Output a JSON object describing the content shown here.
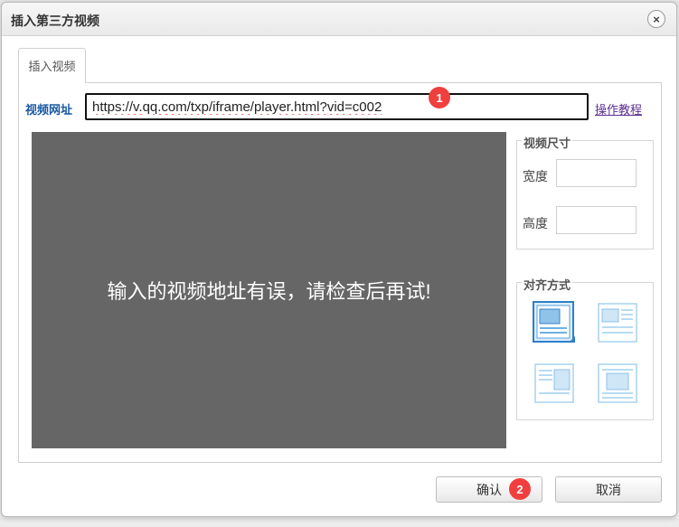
{
  "dialog": {
    "title": "插入第三方视频",
    "close_icon": "×"
  },
  "tabs": [
    {
      "label": "插入视频"
    }
  ],
  "url_row": {
    "label": "视频网址",
    "value": "https://v.qq.com/txp/iframe/player.html?vid=c002",
    "tutorial_link": "操作教程"
  },
  "preview": {
    "message": "输入的视频地址有误，请检查后再试!"
  },
  "video_size": {
    "legend": "视频尺寸",
    "width_label": "宽度",
    "width_value": "",
    "height_label": "高度",
    "height_value": ""
  },
  "alignment": {
    "legend": "对齐方式",
    "options": [
      {
        "icon": "align-none-icon",
        "selected": true
      },
      {
        "icon": "align-left-icon",
        "selected": false
      },
      {
        "icon": "align-right-icon",
        "selected": false
      },
      {
        "icon": "align-center-icon",
        "selected": false
      }
    ]
  },
  "footer": {
    "confirm_label": "确认",
    "cancel_label": "取消"
  },
  "badges": [
    "1",
    "2"
  ],
  "colors": {
    "preview_bg": "#666666",
    "badge": "#f03f3f",
    "label_blue": "#1a5aa3",
    "link_purple": "#5b2f91"
  }
}
